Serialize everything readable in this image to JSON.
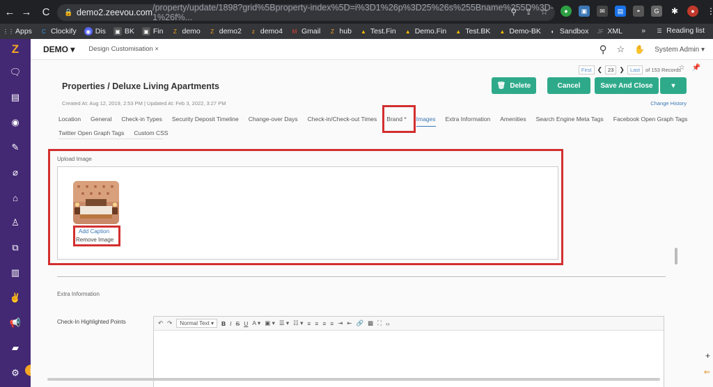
{
  "browser": {
    "host": "demo2.zeevou.com",
    "path": "/property/update/1898?grid%5Bproperty-index%5D=i%3D1%26p%3D25%26s%255Bname%255D%3D-1%26f%...",
    "bookmarks": [
      "Apps",
      "Clockify",
      "Dis",
      "BK",
      "Fin",
      "demo",
      "demo2",
      "demo4",
      "Gmail",
      "hub",
      "Test.Fin",
      "Demo.Fin",
      "Test.BK",
      "Demo-BK",
      "Sandbox",
      "XML"
    ],
    "reading_list": "Reading list",
    "more": "»"
  },
  "header": {
    "brand": "DEMO",
    "tab": "Design Customisation",
    "user": "System Admin"
  },
  "pager": {
    "first": "First",
    "page": "23",
    "last": "Last",
    "of": "of 153 Records"
  },
  "page": {
    "title": "Properties / Deluxe Living Apartments",
    "meta": "Created At: Aug 12, 2019, 2:53 PM | Updated At: Feb 3, 2022, 3:27 PM",
    "change_history": "Change History"
  },
  "buttons": {
    "delete": "Delete",
    "cancel": "Cancel",
    "save_close": "Save And Close",
    "more": "▾"
  },
  "tabs": [
    "Location",
    "General",
    "Check-in Types",
    "Security Deposit Timeline",
    "Change-over Days",
    "Check-in/Check-out Times",
    "Brand *",
    "Images",
    "Extra Information",
    "Amenities",
    "Search Engine Meta Tags",
    "Facebook Open Graph Tags"
  ],
  "tabs2": [
    "Twitter Open Graph Tags",
    "Custom CSS"
  ],
  "images": {
    "section_label": "Upload Image",
    "add_caption": "Add Caption",
    "remove_image": "Remove Image"
  },
  "extra": {
    "section_label": "Extra Information",
    "field_label": "Check-In Highlighted Points",
    "format": "Normal Text"
  },
  "colors": {
    "sidebar": "#432874",
    "accent": "#2eaa8a",
    "highlight": "#d32f2f"
  }
}
